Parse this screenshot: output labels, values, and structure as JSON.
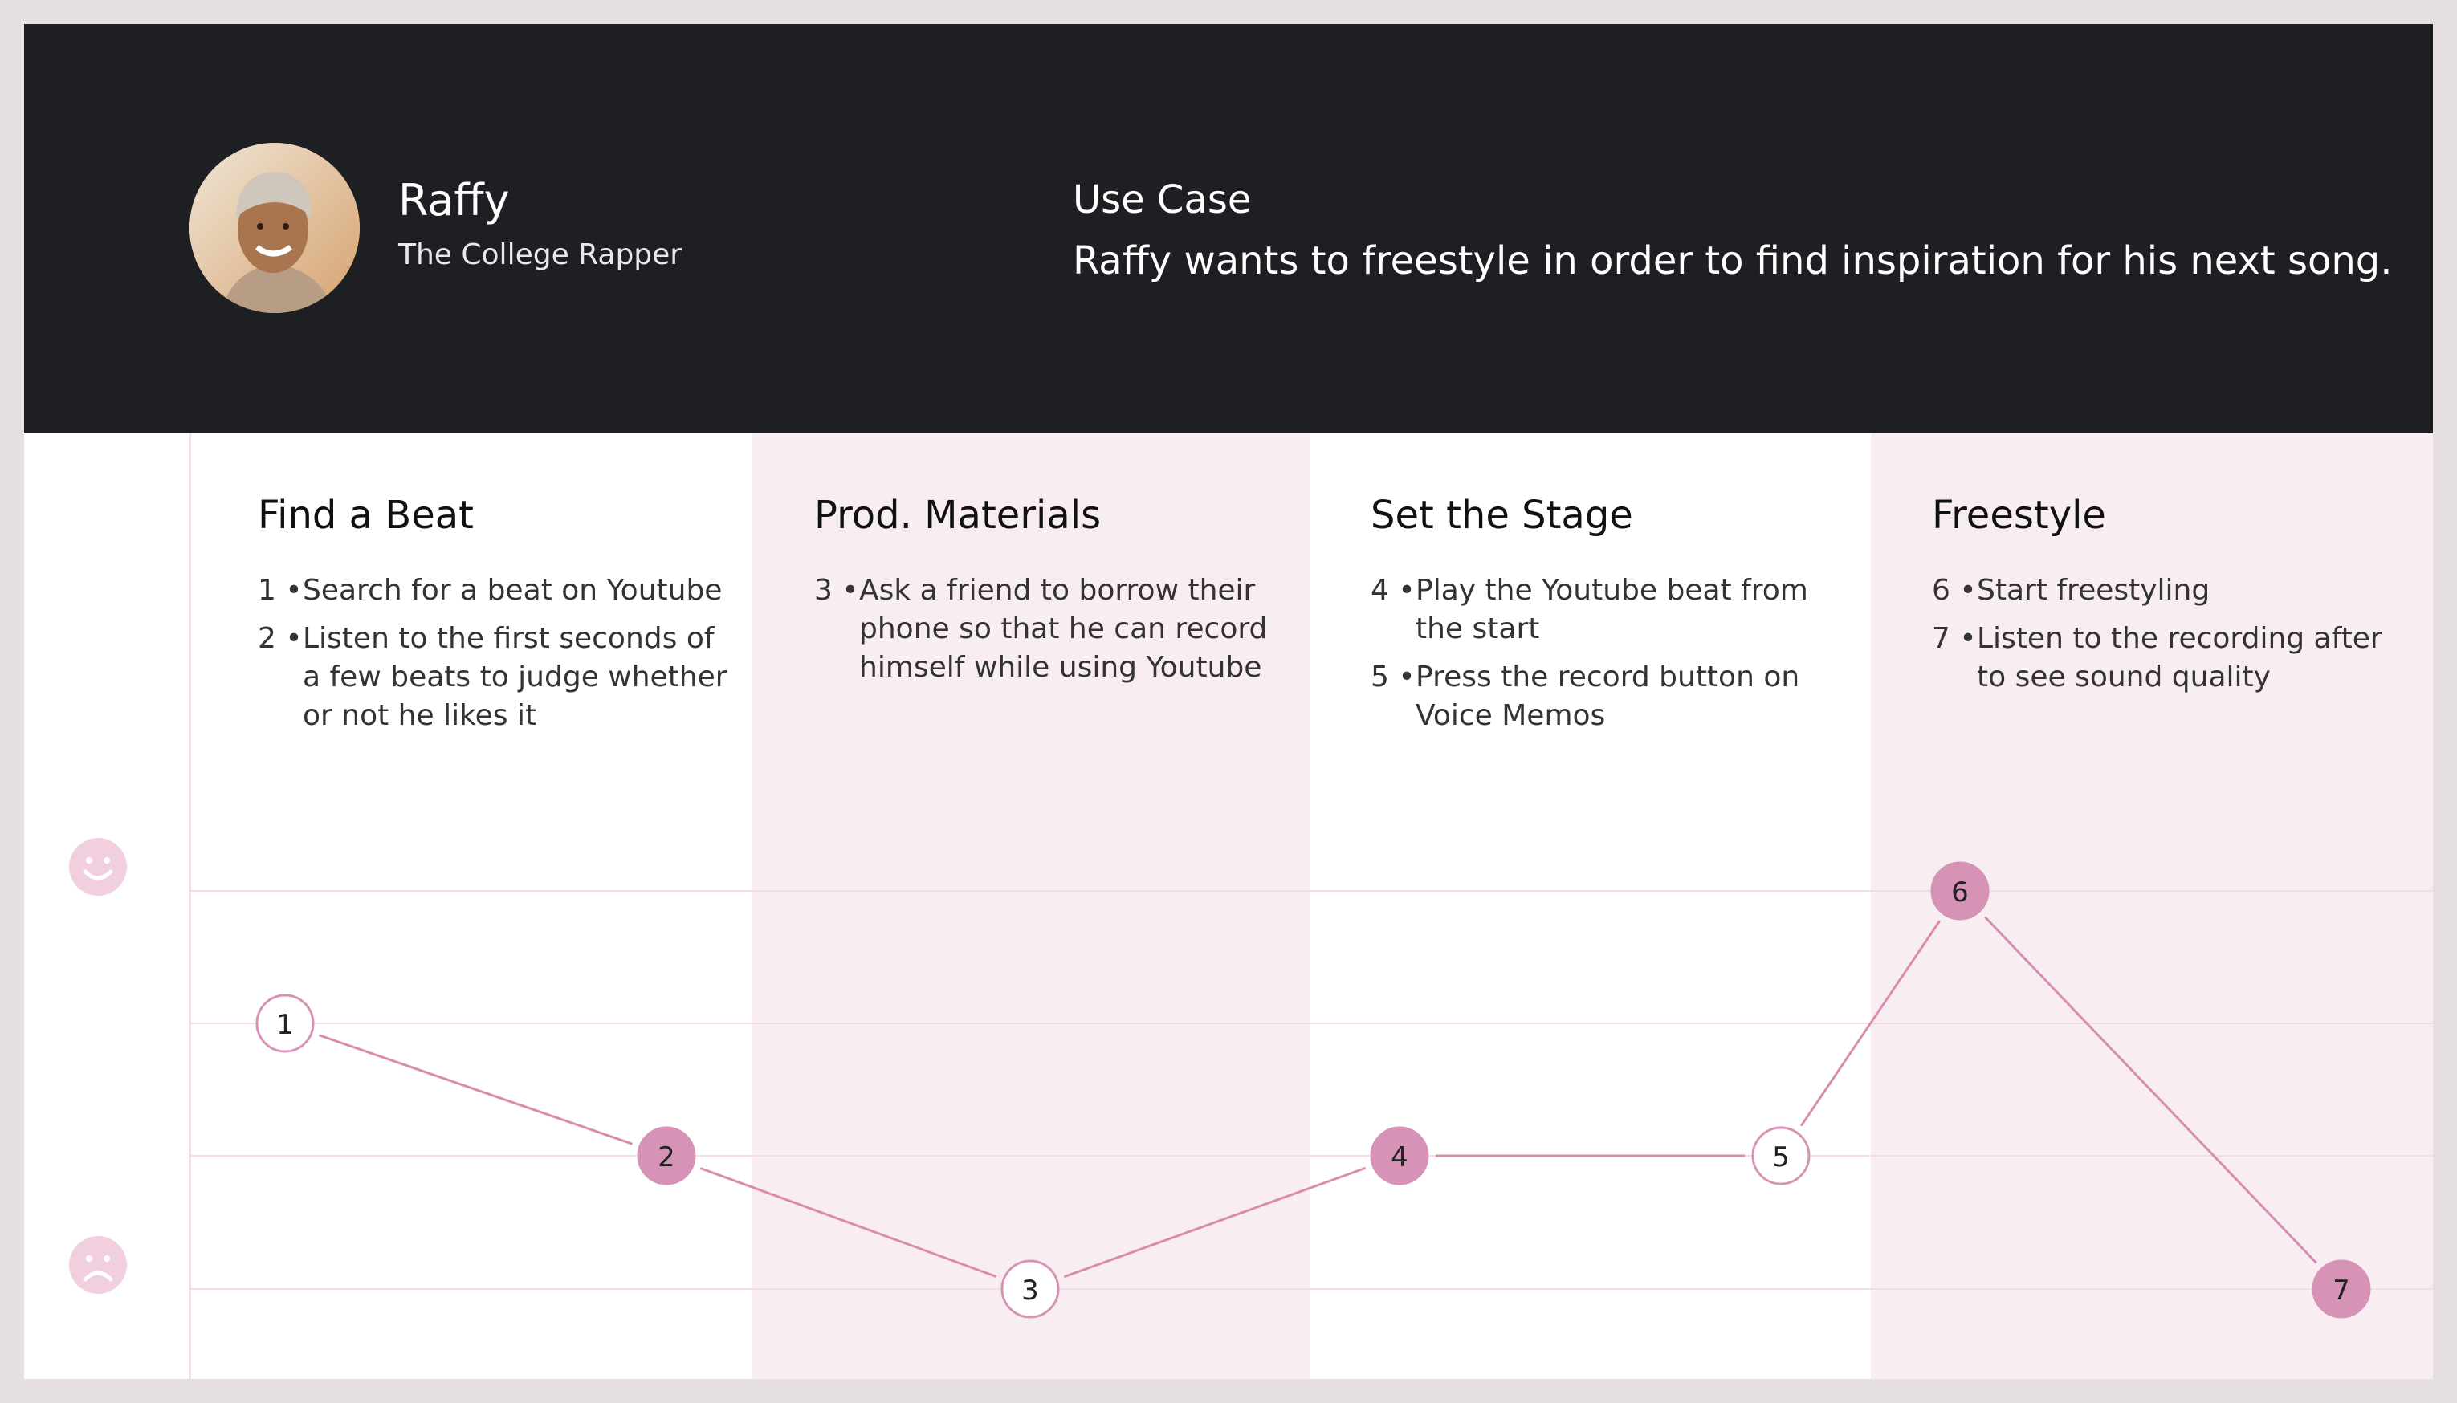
{
  "persona": {
    "name": "Raffy",
    "role": "The College Rapper",
    "avatar_icon": "person-photo"
  },
  "use_case": {
    "title": "Use Case",
    "text": "Raffy wants to freestyle in order to find inspiration for his next song."
  },
  "stages": [
    {
      "title": "Find a Beat",
      "steps": [
        {
          "num": "1 •",
          "text": "Search for a beat on Youtube"
        },
        {
          "num": "2 •",
          "text": "Listen to the first seconds of a few beats to judge whether or not he likes it"
        }
      ]
    },
    {
      "title": "Prod. Materials",
      "steps": [
        {
          "num": "3 •",
          "text": "Ask a friend to borrow their phone so that he can record himself while using Youtube"
        }
      ]
    },
    {
      "title": "Set the Stage",
      "steps": [
        {
          "num": "4 •",
          "text": "Play the Youtube beat from the start"
        },
        {
          "num": "5 •",
          "text": "Press the record button on Voice Memos"
        }
      ]
    },
    {
      "title": "Freestyle",
      "steps": [
        {
          "num": "6 •",
          "text": "Start freestyling"
        },
        {
          "num": "7 •",
          "text": "Listen to the recording after to see sound quality"
        }
      ]
    }
  ],
  "journey": {
    "levels": [
      "happy",
      "slightly positive",
      "slightly negative",
      "sad"
    ],
    "points": [
      {
        "label": "1",
        "level": 2,
        "filled": false
      },
      {
        "label": "2",
        "level": 1,
        "filled": true
      },
      {
        "label": "3",
        "level": 0,
        "filled": false
      },
      {
        "label": "4",
        "level": 1,
        "filled": true
      },
      {
        "label": "5",
        "level": 1,
        "filled": false
      },
      {
        "label": "6",
        "level": 3,
        "filled": true
      },
      {
        "label": "7",
        "level": 0,
        "filled": true
      }
    ],
    "icons": {
      "top": "smiley-happy-icon",
      "bottom": "smiley-sad-icon"
    },
    "colors": {
      "accent": "#d693b6",
      "line": "#d98cb0",
      "band": "#f8eef2",
      "header": "#1e1f23"
    }
  }
}
